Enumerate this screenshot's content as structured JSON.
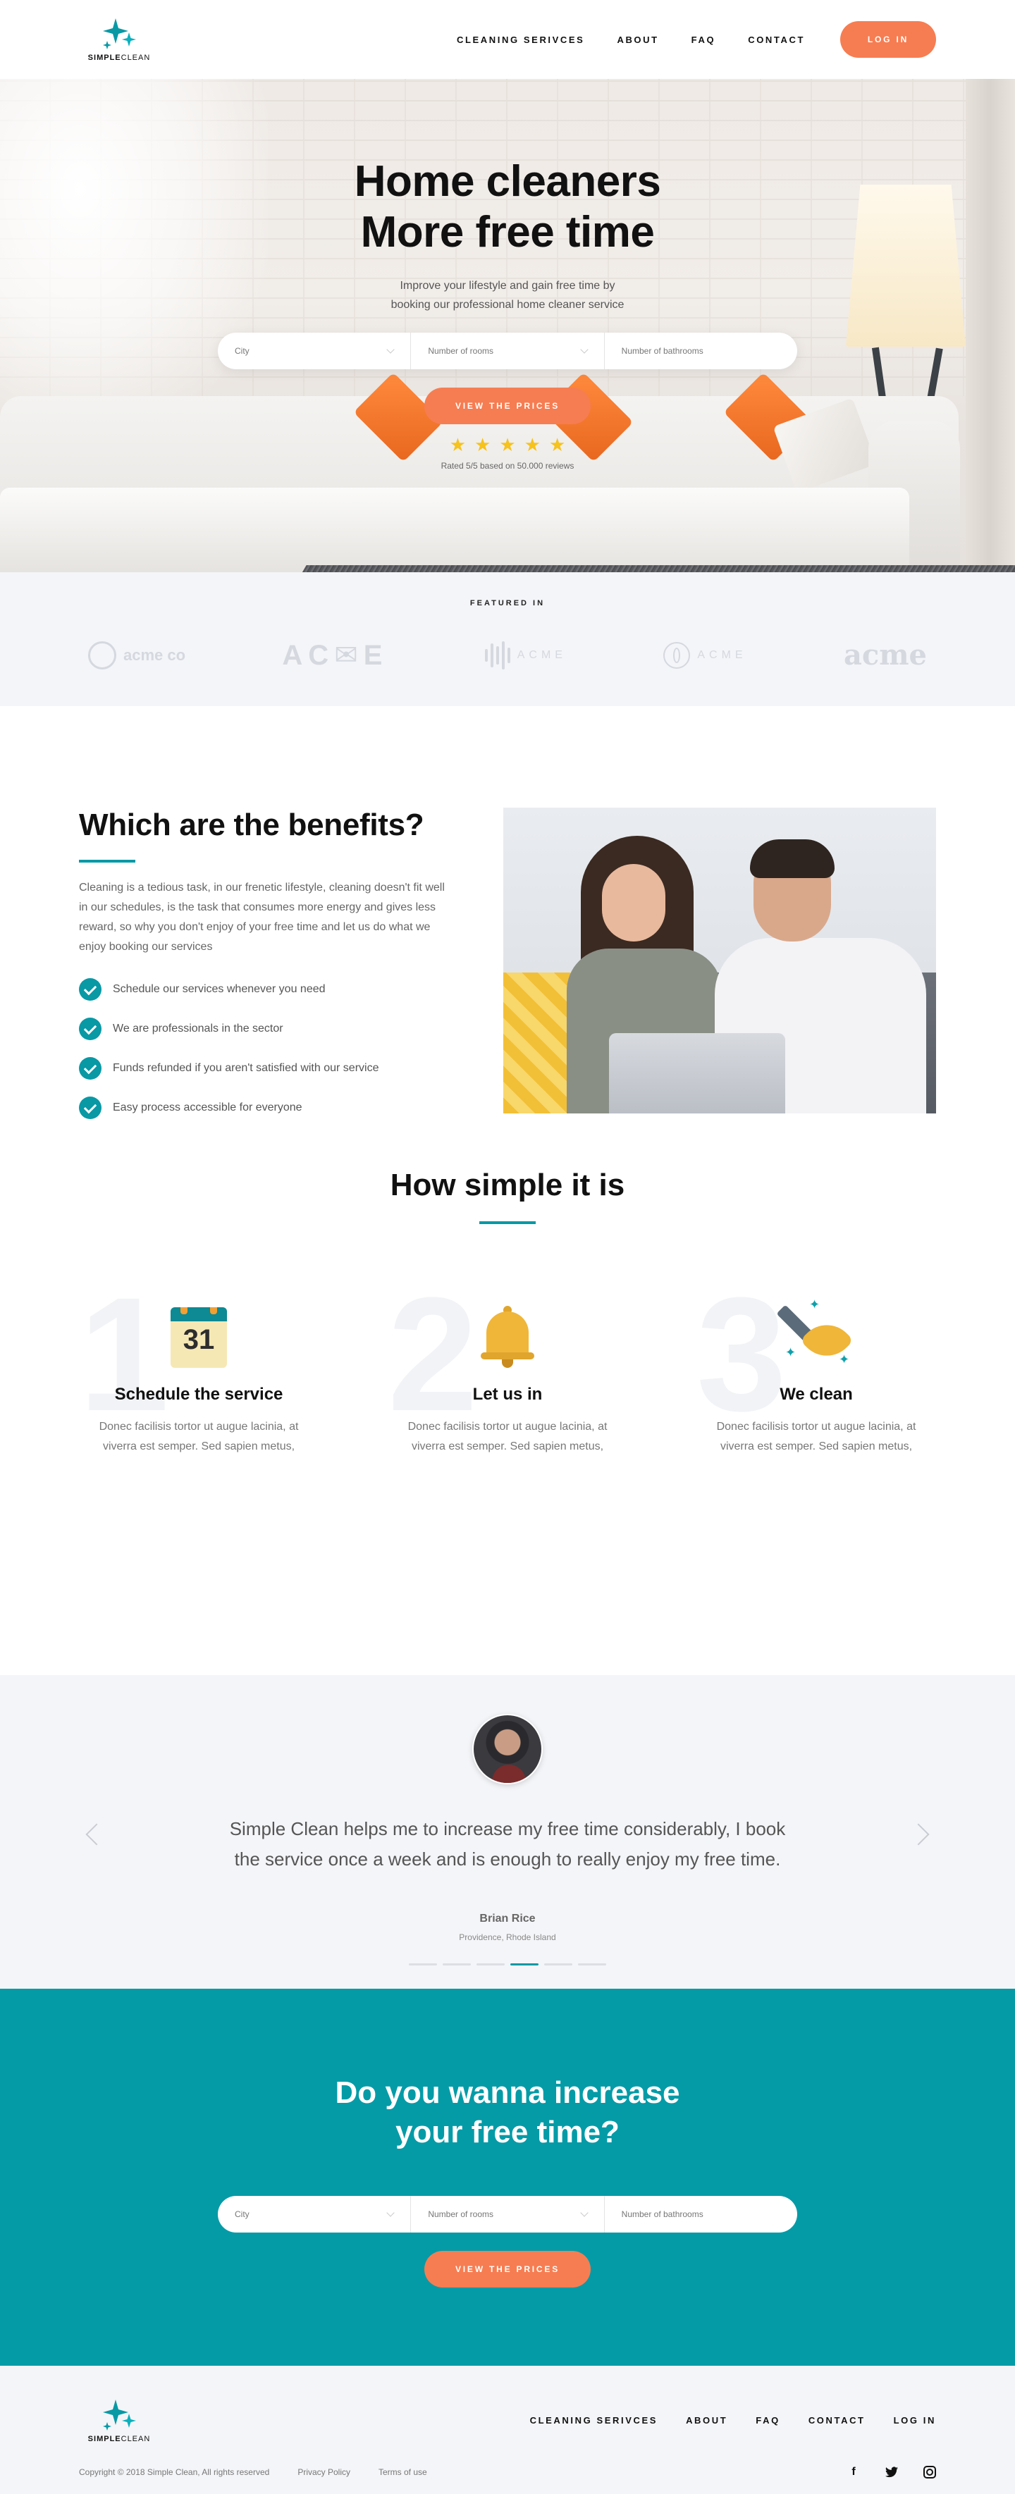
{
  "brand": {
    "name_bold": "SIMPLE",
    "name_light": "CLEAN",
    "accent": "#0899a5",
    "orange": "#f67d52"
  },
  "nav": {
    "items": [
      "CLEANING SERIVCES",
      "ABOUT",
      "FAQ",
      "CONTACT"
    ],
    "login": "LOG IN"
  },
  "hero": {
    "title_line1": "Home cleaners",
    "title_line2": "More free time",
    "subtitle_line1": "Improve your lifestyle and gain free time by",
    "subtitle_line2": "booking our professional home cleaner service",
    "search": {
      "city": "City",
      "rooms": "Number of rooms",
      "bathrooms": "Number of bathrooms"
    },
    "button": "VIEW THE PRICES",
    "rating_stars": 5,
    "rated_text": "Rated 5/5 based on 50.000 reviews"
  },
  "featured": {
    "heading": "FEATURED IN",
    "logos": [
      "acme co",
      "AC✉E",
      "ACME",
      "ACME",
      "acme"
    ]
  },
  "benefits": {
    "title": "Which are the benefits?",
    "text": "Cleaning is a tedious task, in our frenetic lifestyle, cleaning doesn't fit well in our schedules, is the task that consumes more energy and gives less reward, so why you don't enjoy of your free time and let us do what we enjoy booking our services",
    "items": [
      "Schedule our services whenever you need",
      "We are professionals in the sector",
      "Funds refunded if you aren't satisfied with our service",
      "Easy process accessible for everyone"
    ]
  },
  "how": {
    "title": "How simple it is",
    "steps": [
      {
        "num": "1",
        "icon": "calendar-icon",
        "day": "31",
        "title": "Schedule the service",
        "text_line1": "Donec facilisis tortor ut augue lacinia, at",
        "text_line2": "viverra est semper. Sed sapien metus,"
      },
      {
        "num": "2",
        "icon": "bell-icon",
        "title": "Let us in",
        "text_line1": "Donec facilisis tortor ut augue lacinia, at",
        "text_line2": "viverra est semper. Sed sapien metus,"
      },
      {
        "num": "3",
        "icon": "broom-icon",
        "title": "We clean",
        "text_line1": "Donec facilisis tortor ut augue lacinia, at",
        "text_line2": "viverra est semper. Sed sapien metus,"
      }
    ]
  },
  "testimonial": {
    "quote_line1": "Simple Clean helps me to increase my free time considerably, I book",
    "quote_line2": "the service once a week and is enough to really enjoy my free time.",
    "author": "Brian Rice",
    "place": "Providence, Rhode Island",
    "slides": 6,
    "active_slide": 4
  },
  "cta": {
    "title_line1": "Do you wanna increase",
    "title_line2": "your free time?",
    "search": {
      "city": "City",
      "rooms": "Number of rooms",
      "bathrooms": "Number of bathrooms"
    },
    "button": "VIEW THE PRICES"
  },
  "footer": {
    "nav": [
      "CLEANING SERIVCES",
      "ABOUT",
      "FAQ",
      "CONTACT",
      "LOG IN"
    ],
    "copyright": "Copyright © 2018 Simple Clean, All rights reserved",
    "privacy": "Privacy Policy",
    "terms": "Terms of use",
    "social": [
      "facebook-icon",
      "twitter-icon",
      "instagram-icon"
    ]
  }
}
